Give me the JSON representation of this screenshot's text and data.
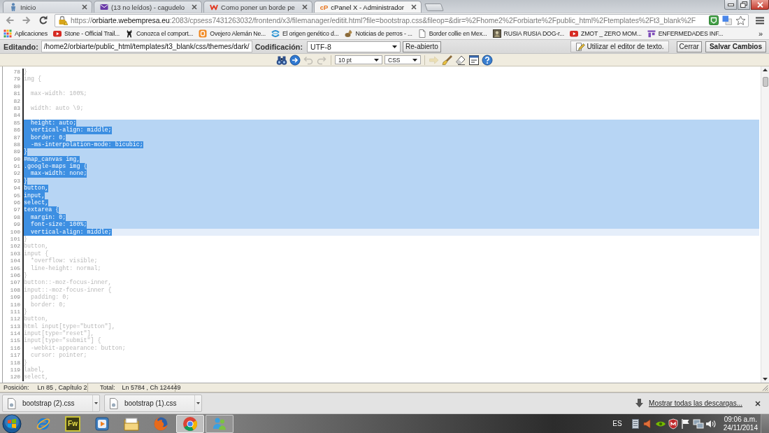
{
  "browser": {
    "tabs": [
      {
        "title": "Inicio",
        "selected": false
      },
      {
        "title": "(13 no leídos) - cagudelo",
        "selected": false
      },
      {
        "title": "Como poner un borde pe",
        "selected": false
      },
      {
        "title": "cPanel X - Administrador",
        "favicon_text": "cP",
        "selected": true
      }
    ],
    "address": {
      "scheme": "https://",
      "host": "orbiarte.webempresa.eu",
      "path": ":2083/cpsess7431263032/frontend/x3/filemanager/editit.html?file=bootstrap.css&fileop=&dir=%2Fhome2%2Forbiarte%2Fpublic_html%2Ftemplates%2Ft3_blank%2F"
    },
    "bookmarks": [
      "Aplicaciones",
      "Stone - Official Trail...",
      "Conozca el comport...",
      "Ovejero Alemán Ne...",
      "El origen genético d...",
      "Noticias de perros - ...",
      "Border collie en Mex...",
      "RUSIA RUSIA DOG-r...",
      "ZMOT _ ZERO MOM...",
      "ENFERMEDADES INF..."
    ],
    "bookmarks_overflow": "»"
  },
  "editor_header": {
    "path_label": "Editando:",
    "path": "/home2/orbiarte/public_html/templates/t3_blank/css/themes/dark/",
    "encoding_label": "Codificación:",
    "encoding": "UTF-8",
    "reopen_button": "Re-abierto",
    "text_editor_button": "Utilizar el editor de texto.",
    "close_button": "Cerrar",
    "save_button": "Salvar Cambios"
  },
  "toolbar": {
    "tools_left": [
      {
        "disabled": false
      },
      {
        "disabled": false
      },
      {
        "disabled": true
      },
      {
        "disabled": true
      }
    ],
    "font_size": "10 pt",
    "syntax": "CSS",
    "tools_right": [
      {
        "disabled": true
      },
      {
        "disabled": false
      },
      {
        "disabled": false
      },
      {
        "disabled": false
      },
      {
        "disabled": false
      }
    ]
  },
  "code": {
    "lines": [
      {
        "number": "78",
        "text": "}",
        "selected": false,
        "current": false
      },
      {
        "number": "79",
        "text": "img {",
        "selected": false,
        "current": false
      },
      {
        "number": "80",
        "selected": false,
        "current": false
      },
      {
        "number": "81",
        "text": "  max-width: 100%;",
        "selected": false,
        "current": false
      },
      {
        "number": "82",
        "selected": false,
        "current": false
      },
      {
        "number": "83",
        "text": "  width: auto \\9;",
        "selected": false,
        "current": false
      },
      {
        "number": "84",
        "selected": false,
        "current": false
      },
      {
        "number": "85",
        "text": "  height: auto;",
        "selected": true,
        "current": false
      },
      {
        "number": "86",
        "text": "  vertical-align: middle;",
        "selected": true,
        "current": false
      },
      {
        "number": "87",
        "text": "  border: 0;",
        "selected": true,
        "current": false
      },
      {
        "number": "88",
        "text": "  -ms-interpolation-mode: bicubic;",
        "selected": true,
        "current": false
      },
      {
        "number": "89",
        "text": "}",
        "selected": true,
        "current": false
      },
      {
        "number": "90",
        "text": "#map_canvas img,",
        "selected": true,
        "current": false
      },
      {
        "number": "91",
        "text": ".google-maps img {",
        "selected": true,
        "current": false
      },
      {
        "number": "92",
        "text": "  max-width: none;",
        "selected": true,
        "current": false
      },
      {
        "number": "93",
        "text": "}",
        "selected": true,
        "current": false
      },
      {
        "number": "94",
        "text": "button,",
        "selected": true,
        "current": false
      },
      {
        "number": "95",
        "text": "input,",
        "selected": true,
        "current": false
      },
      {
        "number": "96",
        "text": "select,",
        "selected": true,
        "current": false
      },
      {
        "number": "97",
        "text": "textarea {",
        "selected": true,
        "current": false
      },
      {
        "number": "98",
        "text": "  margin: 0;",
        "selected": true,
        "current": false
      },
      {
        "number": "99",
        "text": "  font-size: 100%;",
        "selected": true,
        "current": false
      },
      {
        "number": "100",
        "text": "  vertical-align: middle;",
        "selected": true,
        "current": true
      },
      {
        "number": "101",
        "text": "}",
        "selected": false,
        "current": false
      },
      {
        "number": "102",
        "text": "button,",
        "selected": false,
        "current": false
      },
      {
        "number": "103",
        "text": "input {",
        "selected": false,
        "current": false
      },
      {
        "number": "104",
        "text": "  *overflow: visible;",
        "selected": false,
        "current": false
      },
      {
        "number": "105",
        "text": "  line-height: normal;",
        "selected": false,
        "current": false
      },
      {
        "number": "106",
        "text": "}",
        "selected": false,
        "current": false
      },
      {
        "number": "107",
        "text": "button::-moz-focus-inner,",
        "selected": false,
        "current": false
      },
      {
        "number": "108",
        "text": "input::-moz-focus-inner {",
        "selected": false,
        "current": false
      },
      {
        "number": "109",
        "text": "  padding: 0;",
        "selected": false,
        "current": false
      },
      {
        "number": "110",
        "text": "  border: 0;",
        "selected": false,
        "current": false
      },
      {
        "number": "111",
        "text": "}",
        "selected": false,
        "current": false
      },
      {
        "number": "112",
        "text": "button,",
        "selected": false,
        "current": false
      },
      {
        "number": "113",
        "text": "html input[type=\"button\"],",
        "selected": false,
        "current": false
      },
      {
        "number": "114",
        "text": "input[type=\"reset\"],",
        "selected": false,
        "current": false
      },
      {
        "number": "115",
        "text": "input[type=\"submit\"] {",
        "selected": false,
        "current": false
      },
      {
        "number": "116",
        "text": "  -webkit-appearance: button;",
        "selected": false,
        "current": false
      },
      {
        "number": "117",
        "text": "  cursor: pointer;",
        "selected": false,
        "current": false
      },
      {
        "number": "118",
        "text": "}",
        "selected": false,
        "current": false
      },
      {
        "number": "119",
        "text": "label,",
        "selected": false,
        "current": false
      },
      {
        "number": "120",
        "text": "select,",
        "selected": false,
        "current": false
      }
    ]
  },
  "status_bar": {
    "position_label": "Posición:",
    "position": "Ln 85 , Capítulo 2",
    "total_label": "Total:",
    "total": "Ln 5784 , Ch 124449"
  },
  "downloads": {
    "items": [
      {
        "name": "bootstrap (2).css"
      },
      {
        "name": "bootstrap (1).css"
      }
    ],
    "show_all": "Mostrar todas las descargas..."
  },
  "taskbar": {
    "apps": [
      {
        "running": false,
        "selected": false
      },
      {
        "label": "Fw",
        "running": false,
        "selected": false
      },
      {
        "running": false,
        "selected": false
      },
      {
        "running": false,
        "selected": false
      },
      {
        "running": false,
        "selected": false
      },
      {
        "running": true,
        "selected": true
      },
      {
        "running": true,
        "selected": false
      }
    ],
    "language": "ES",
    "time": "09:06 a.m.",
    "date": "24/11/2014"
  }
}
